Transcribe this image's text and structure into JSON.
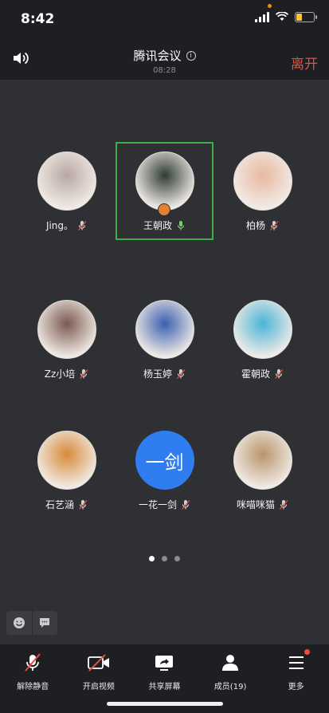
{
  "status_bar": {
    "time": "8:42"
  },
  "header": {
    "title": "腾讯会议",
    "duration": "08:28",
    "leave_label": "离开"
  },
  "participants": [
    {
      "name": "Jing。",
      "muted": true,
      "active": false,
      "avatar_color": "#b9a7a2"
    },
    {
      "name": "王朝政",
      "muted": false,
      "active": true,
      "host": true,
      "avatar_color": "#2f3b36"
    },
    {
      "name": "柏杨",
      "muted": true,
      "active": false,
      "avatar_color": "#e8b8a0"
    },
    {
      "name": "Zz小培",
      "muted": true,
      "active": false,
      "avatar_color": "#7a5a50"
    },
    {
      "name": "杨玉婷",
      "muted": true,
      "active": false,
      "avatar_color": "#3a5fb0"
    },
    {
      "name": "霍朝政",
      "muted": true,
      "active": false,
      "avatar_color": "#4ab4d8"
    },
    {
      "name": "石艺涵",
      "muted": true,
      "active": false,
      "avatar_color": "#d88a3a"
    },
    {
      "name": "一花一剑",
      "muted": true,
      "active": false,
      "avatar_text": "一剑",
      "avatar_color": "#2f7df0"
    },
    {
      "name": "咪喵咪猫",
      "muted": true,
      "active": false,
      "avatar_color": "#b8946c"
    }
  ],
  "pager": {
    "pages": 3,
    "current": 1
  },
  "toolbar": {
    "unmute": "解除静音",
    "video": "开启视频",
    "share": "共享屏幕",
    "members": "成员(19)",
    "more": "更多"
  },
  "colors": {
    "active_border": "#3bb045",
    "leave": "#e84d3d",
    "mute": "#e84d3d"
  }
}
